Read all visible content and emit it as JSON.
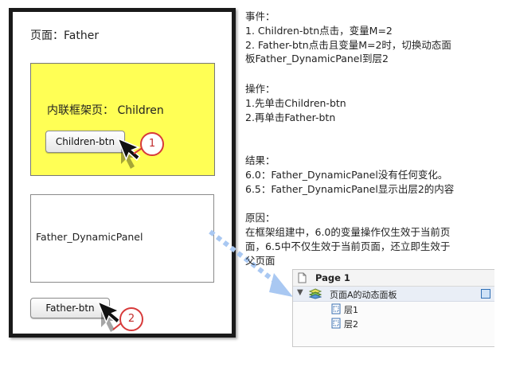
{
  "father": {
    "title": "页面：Father",
    "iframe_title": "内联框架页：  Children",
    "children_btn": "Children-btn",
    "dynamic_panel_label": "Father_DynamicPanel",
    "father_btn": "Father-btn",
    "badge1": "1",
    "badge2": "2"
  },
  "notes": {
    "events_heading": "事件：",
    "event1": "1. Children-btn点击，变量M=2",
    "event2a": "2. Father-btn点击且变量M=2时，切换动态面",
    "event2b": "板Father_DynamicPanel到层2",
    "ops_heading": "操作：",
    "op1": "1.先单击Children-btn",
    "op2": "2.再单击Father-btn",
    "result_heading": "结果：",
    "result1": "6.0：Father_DynamicPanel没有任何变化。",
    "result2": "6.5：Father_DynamicPanel显示出层2的内容",
    "reason_heading": "原因：",
    "reason1": "在框架组建中，6.0的变量操作仅生效于当前页",
    "reason2": "面，6.5中不仅生效于当前页面，还立即生效于",
    "reason3": "父页面"
  },
  "tree": {
    "page": "Page 1",
    "panel": "页面A的动态面板",
    "layer1": "层1",
    "layer2": "层2"
  },
  "colors": {
    "yellow": "#ffff55",
    "arrow": "#a9c8f2",
    "badge": "#d73a3a"
  }
}
